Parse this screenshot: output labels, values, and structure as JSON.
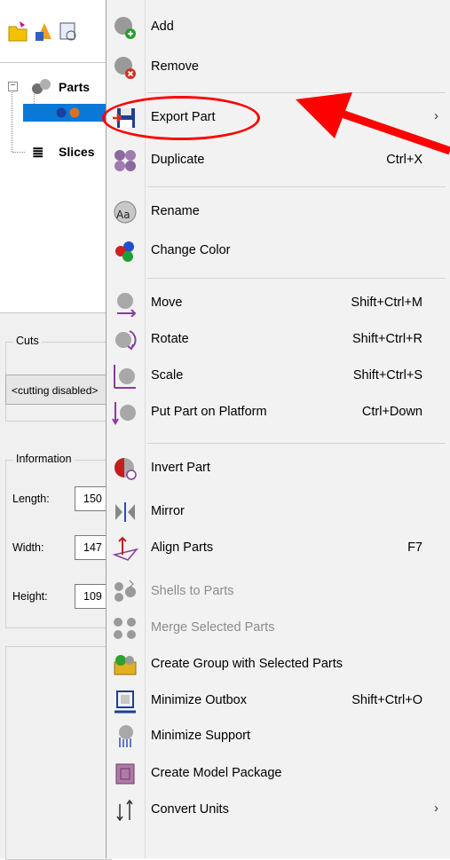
{
  "tree": {
    "parts_label": "Parts",
    "slices_label": "Slices"
  },
  "cuts": {
    "group_title": "Cuts",
    "selected": "<cutting disabled>"
  },
  "info": {
    "group_title": "Information",
    "rows": [
      {
        "label": "Length:",
        "value": "150"
      },
      {
        "label": "Width:",
        "value": "147"
      },
      {
        "label": "Height:",
        "value": "109"
      }
    ]
  },
  "menu": {
    "items": [
      {
        "label": "Add",
        "shortcut": "",
        "icon": "add-icon"
      },
      {
        "label": "Remove",
        "shortcut": "",
        "icon": "remove-icon"
      },
      {
        "label": "Export Part",
        "shortcut": "",
        "icon": "save-disk-icon",
        "submenu": true
      },
      {
        "label": "Duplicate",
        "shortcut": "Ctrl+X",
        "icon": "duplicate-icon"
      },
      {
        "label": "Rename",
        "shortcut": "",
        "icon": "rename-icon"
      },
      {
        "label": "Change Color",
        "shortcut": "",
        "icon": "color-dots-icon"
      },
      {
        "label": "Move",
        "shortcut": "Shift+Ctrl+M",
        "icon": "move-icon"
      },
      {
        "label": "Rotate",
        "shortcut": "Shift+Ctrl+R",
        "icon": "rotate-icon"
      },
      {
        "label": "Scale",
        "shortcut": "Shift+Ctrl+S",
        "icon": "scale-icon"
      },
      {
        "label": "Put Part on Platform",
        "shortcut": "Ctrl+Down",
        "icon": "platform-icon"
      },
      {
        "label": "Invert Part",
        "shortcut": "",
        "icon": "invert-icon"
      },
      {
        "label": "Mirror",
        "shortcut": "",
        "icon": "mirror-icon"
      },
      {
        "label": "Align Parts",
        "shortcut": "F7",
        "icon": "align-icon"
      },
      {
        "label": "Shells to Parts",
        "shortcut": "",
        "icon": "shells-icon",
        "disabled": true
      },
      {
        "label": "Merge Selected Parts",
        "shortcut": "",
        "icon": "merge-icon",
        "disabled": true
      },
      {
        "label": "Create Group with Selected Parts",
        "shortcut": "",
        "icon": "group-icon"
      },
      {
        "label": "Minimize Outbox",
        "shortcut": "Shift+Ctrl+O",
        "icon": "outbox-icon"
      },
      {
        "label": "Minimize Support",
        "shortcut": "",
        "icon": "support-icon"
      },
      {
        "label": "Create Model Package",
        "shortcut": "",
        "icon": "package-icon"
      },
      {
        "label": "Convert Units",
        "shortcut": "",
        "icon": "units-icon",
        "submenu": true
      }
    ],
    "submenu_arrow": "›"
  },
  "colors": {
    "annotation": "#ff0000",
    "selection": "#0a78d7",
    "hover": "#cce4f7"
  }
}
